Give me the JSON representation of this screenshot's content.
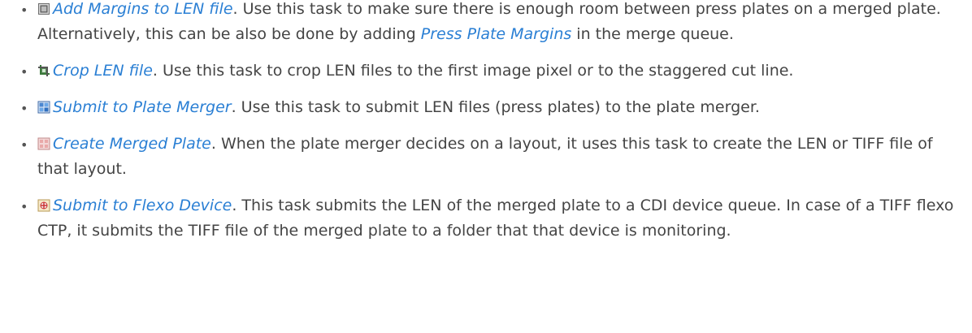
{
  "items": [
    {
      "icon": "margins-icon",
      "link": "Add Margins to LEN file",
      "text_1": ". Use this task to make sure there is enough room between press plates on a merged plate. Alternatively, this can be also be done by adding ",
      "link_2": "Press Plate Margins",
      "text_2": " in the merge queue."
    },
    {
      "icon": "crop-icon",
      "link": "Crop LEN file",
      "text_1": ". Use this task to crop LEN files to the first image pixel or to the staggered cut line."
    },
    {
      "icon": "plate-merger-icon",
      "link": "Submit to Plate Merger",
      "text_1": ". Use this task to submit LEN files (press plates) to the plate merger."
    },
    {
      "icon": "merged-plate-icon",
      "link": "Create Merged Plate",
      "text_1": ". When the plate merger decides on a layout, it uses this task to create the LEN or TIFF file of that layout."
    },
    {
      "icon": "flexo-device-icon",
      "link": "Submit to Flexo Device",
      "text_1": ". This task submits the LEN of the merged plate to a CDI device queue. In case of a TIFF flexo CTP, it submits the TIFF file of the merged plate to a folder that that device is monitoring."
    }
  ],
  "bullet_char": "•",
  "colors": {
    "link": "#2a7fd4",
    "text": "#444444"
  }
}
